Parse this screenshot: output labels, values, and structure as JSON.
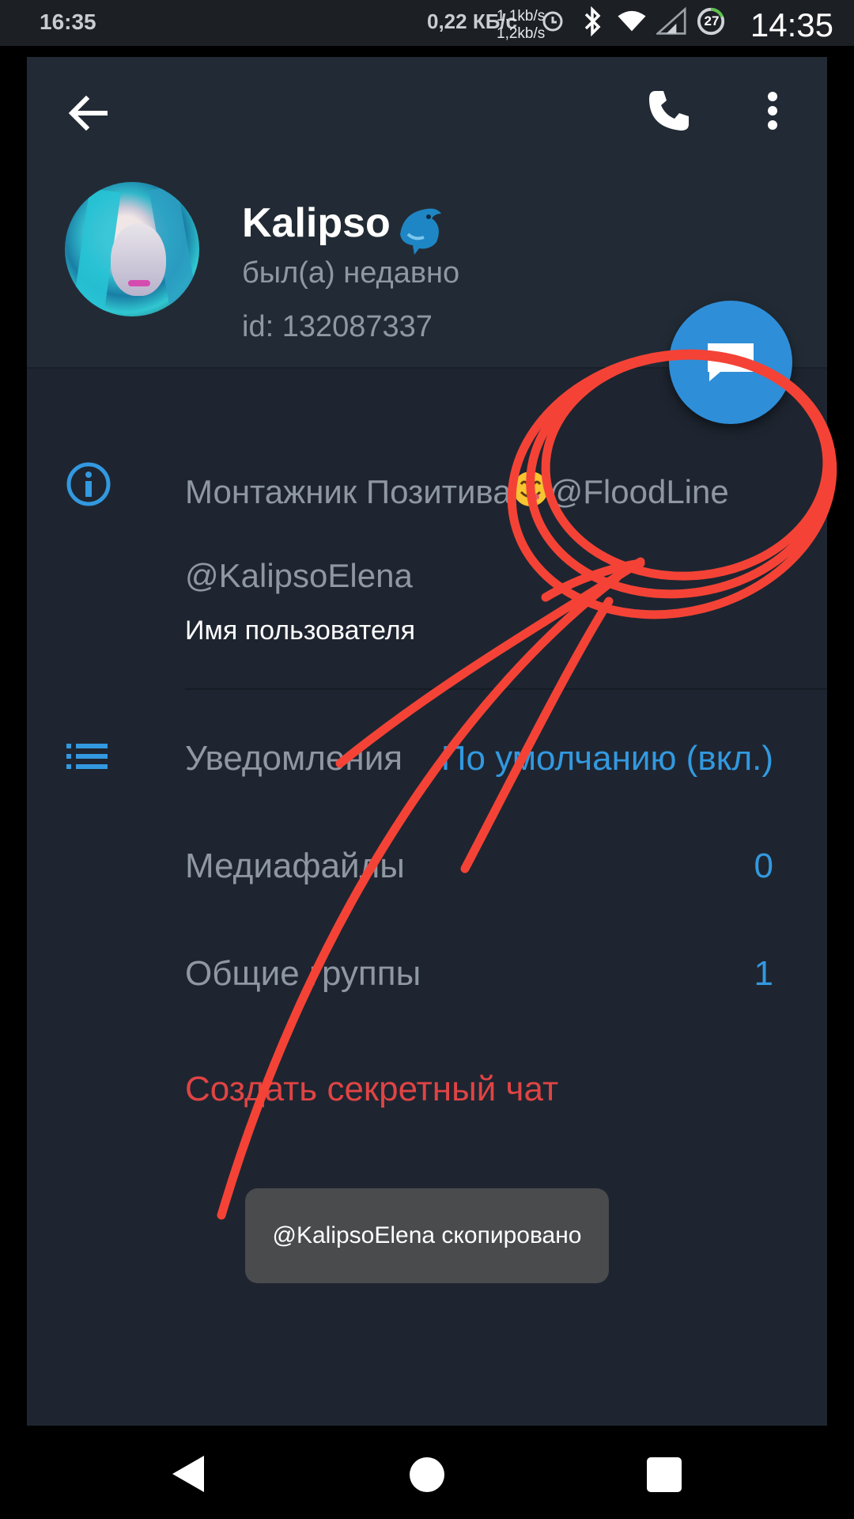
{
  "status_bar": {
    "time_left": "16:35",
    "speed": "0,22 КБ/с",
    "upload": "1,1kb/s",
    "download": "1,2kb/s",
    "battery_level": "27",
    "time_right": "14:35"
  },
  "icons": {
    "back": "arrow-left-icon",
    "call": "phone-icon",
    "more": "more-vertical-icon",
    "info": "info-icon",
    "notifications": "list-icon",
    "message": "message-icon",
    "emoji_name": "dolphin-icon",
    "emoji_bio": "smile-icon"
  },
  "profile": {
    "name": "Kalipso",
    "last_seen": "был(а) недавно",
    "id": "id: 132087337"
  },
  "info": {
    "bio_prefix": "Монтажник Позитива",
    "bio_suffix": "@FloodLine",
    "username": "@KalipsoElena",
    "username_label": "Имя пользователя"
  },
  "rows": {
    "notifications_label": "Уведомления",
    "notifications_value": "По умолчанию (вкл.)",
    "media_label": "Медиафайлы",
    "media_value": "0",
    "groups_label": "Общие группы",
    "groups_value": "1",
    "secret_chat": "Создать секретный чат"
  },
  "toast": {
    "text": "@KalipsoElena скопировано"
  },
  "colors": {
    "accent": "#3399e0",
    "danger": "#e04444",
    "background": "#1e2530",
    "header": "#222b35",
    "annotation": "#f44336"
  }
}
